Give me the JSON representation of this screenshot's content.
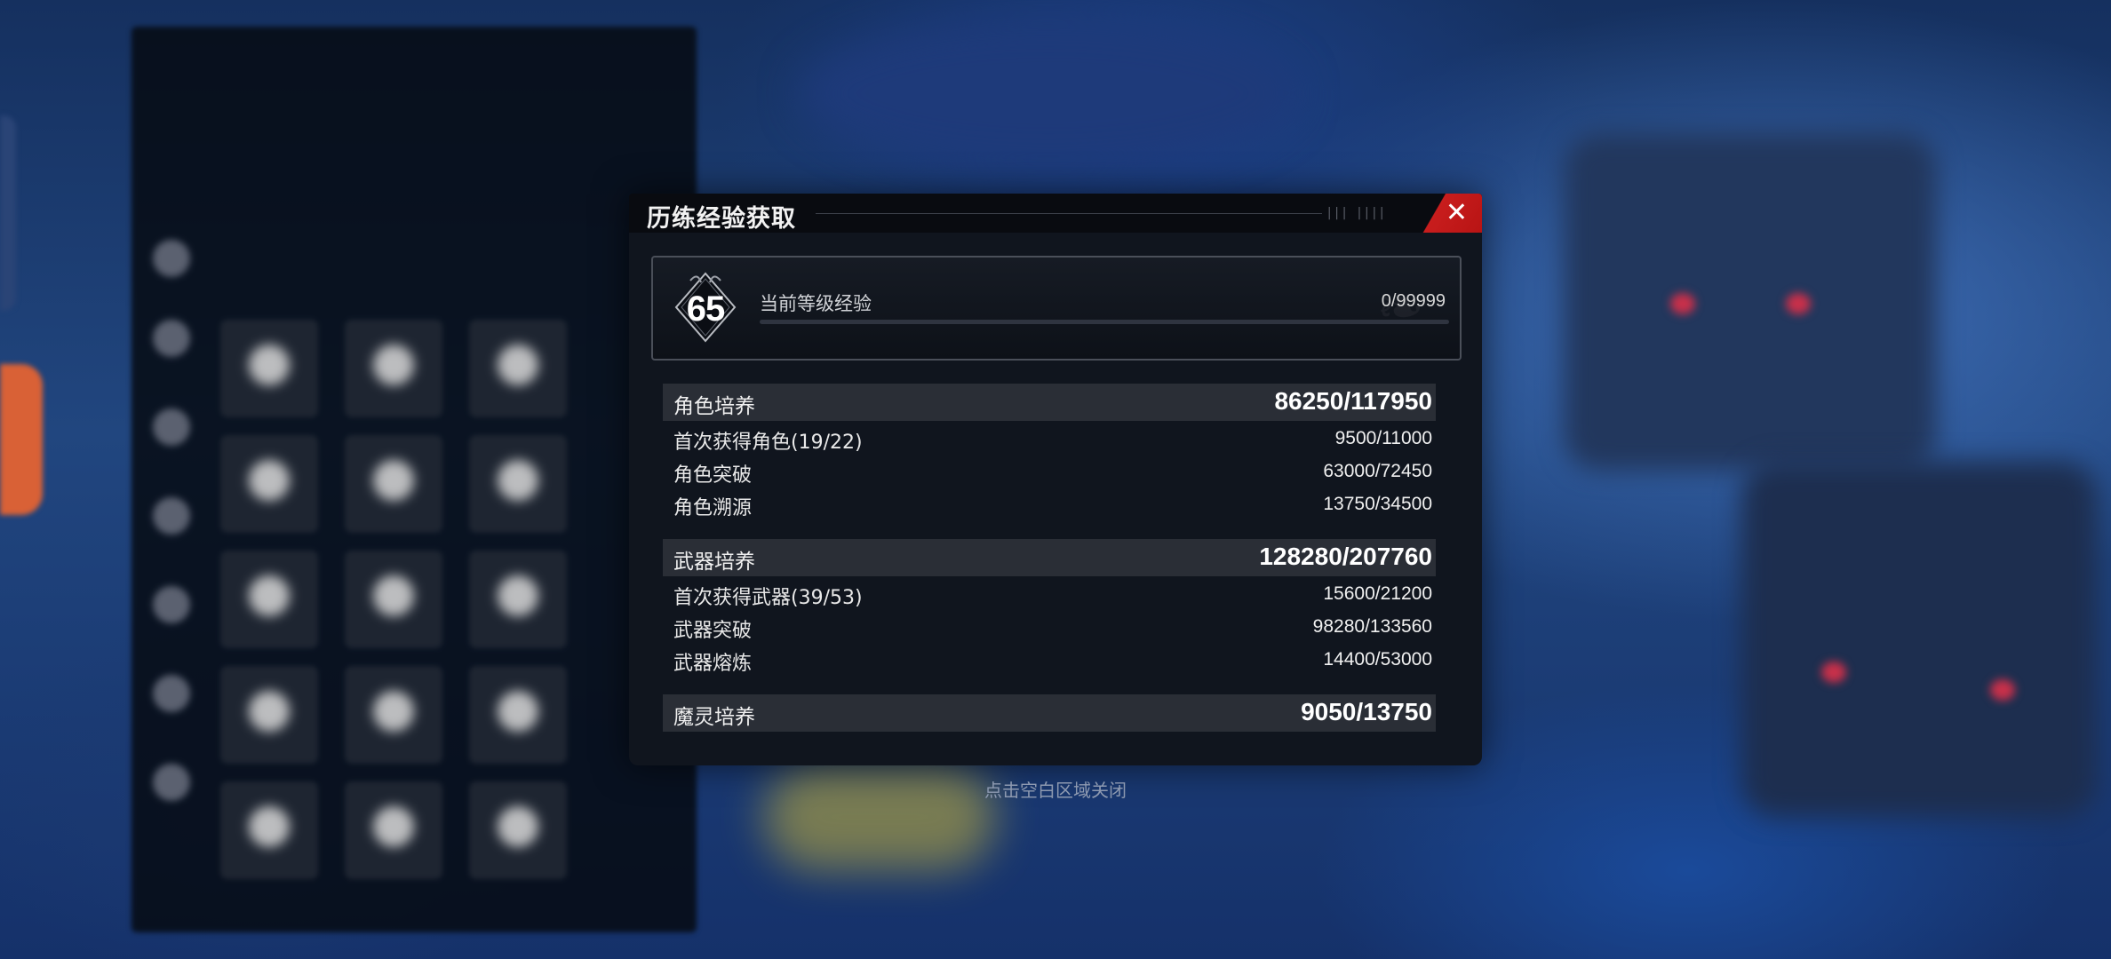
{
  "modal": {
    "title": "历练经验获取",
    "title_deco": "||| ||||",
    "close_label": "✕"
  },
  "level": {
    "number": "65",
    "label": "当前等级经验",
    "value": "0/99999",
    "progress_fraction": 0
  },
  "categories": [
    {
      "name": "角色培养",
      "value": "86250",
      "total": "/117950",
      "items": [
        {
          "name": "首次获得角色(19/22)",
          "value": "9500",
          "total": "/11000"
        },
        {
          "name": "角色突破",
          "value": "63000",
          "total": "/72450"
        },
        {
          "name": "角色溯源",
          "value": "13750",
          "total": "/34500"
        }
      ]
    },
    {
      "name": "武器培养",
      "value": "128280",
      "total": "/207760",
      "items": [
        {
          "name": "首次获得武器(39/53)",
          "value": "15600",
          "total": "/21200"
        },
        {
          "name": "武器突破",
          "value": "98280",
          "total": "/133560"
        },
        {
          "name": "武器熔炼",
          "value": "14400",
          "total": "/53000"
        }
      ]
    },
    {
      "name": "魔灵培养",
      "value": "9050",
      "total": "/13750",
      "items": []
    }
  ],
  "hint": "点击空白区域关闭",
  "colors": {
    "close_red": "#c81d1d",
    "panel_bg": "#10151e",
    "category_bg": "#2a2e36"
  }
}
